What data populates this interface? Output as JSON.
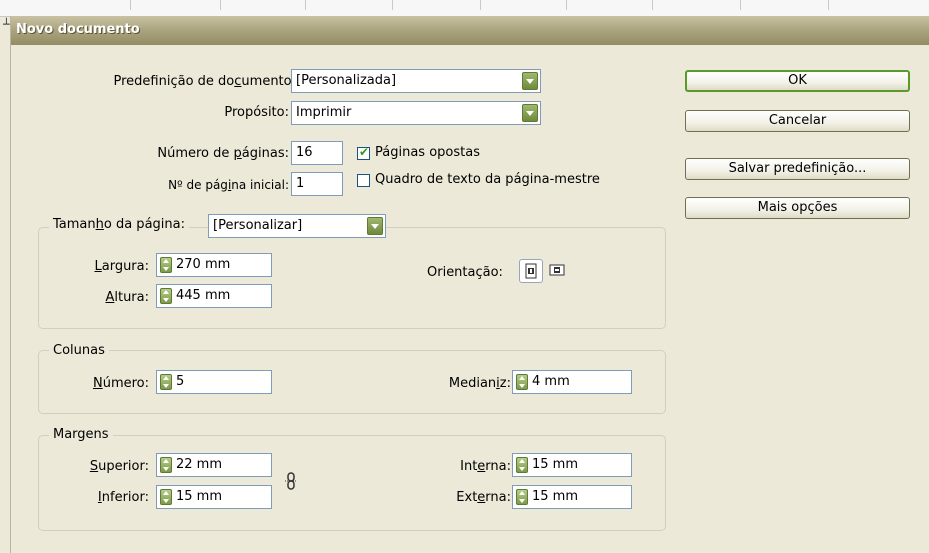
{
  "dialog": {
    "title": "Novo documento"
  },
  "top_mark": "┴",
  "preset": {
    "label_parts": [
      "Predefinição de do",
      "c",
      "umento:"
    ],
    "value": "[Personalizada]"
  },
  "purpose": {
    "label": "Propósito:",
    "value": "Imprimir"
  },
  "num_pages": {
    "label_parts": [
      "Número de ",
      "p",
      "áginas:"
    ],
    "value": "16"
  },
  "start_page": {
    "label_parts": [
      "Nº de pág",
      "i",
      "na inicial:"
    ],
    "value": "1"
  },
  "facing_pages": {
    "label": "Páginas opostas",
    "checked": true
  },
  "master_text_frame": {
    "label": "Quadro de texto da página-mestre",
    "checked": false
  },
  "buttons": {
    "ok": "OK",
    "cancel": "Cancelar",
    "save_preset": "Salvar predefinição...",
    "more_options": "Mais opções"
  },
  "page_size": {
    "legend_parts": [
      "Taman",
      "h",
      "o da página:"
    ],
    "value": "[Personalizar]",
    "width_label": [
      "L",
      "argura:"
    ],
    "width_value": "270 mm",
    "height_label": [
      "A",
      "ltura:"
    ],
    "height_value": "445 mm",
    "orientation_label": "Orientação:",
    "portrait_icon": "portrait-icon",
    "landscape_icon": "landscape-icon"
  },
  "columns": {
    "legend": "Colunas",
    "number_label": [
      "N",
      "úmero:"
    ],
    "number_value": "5",
    "gutter_label": [
      "Median",
      "i",
      "z:"
    ],
    "gutter_value": "4 mm"
  },
  "margins": {
    "legend": "Margens",
    "top_label": [
      "S",
      "uperior:"
    ],
    "top_value": "22 mm",
    "bottom_label": [
      "I",
      "nferior:"
    ],
    "bottom_value": "15 mm",
    "inside_label": [
      "Int",
      "e",
      "rna:"
    ],
    "inside_value": "15 mm",
    "outside_label": [
      "Ext",
      "e",
      "rna:"
    ],
    "outside_value": "15 mm",
    "link_icon": "chain-link-icon"
  },
  "colors": {
    "title_bar": "#aaa37d",
    "dialog_bg": "#ece9d8",
    "accent_green": "#6e8a3c",
    "default_button_border": "#5a9a2c"
  }
}
